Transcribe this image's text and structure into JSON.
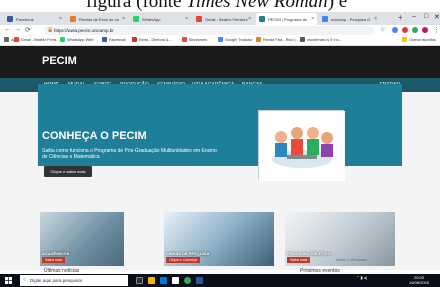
{
  "caption_above": {
    "pre": "figura (fonte ",
    "italic": "Times New Roman",
    "post": ") e"
  },
  "browser": {
    "tabs": [
      {
        "label": "Facebook",
        "color": "#3b5998"
      },
      {
        "label": "Revista de Ecos de on",
        "color": "#e67e22"
      },
      {
        "label": "WhatsApp",
        "color": "#25d366"
      },
      {
        "label": "Gmail - Beatriz Ferrarini",
        "color": "#ea4335"
      },
      {
        "label": "PECIM | Programa de",
        "color": "#1f7f99",
        "active": true
      },
      {
        "label": "unicamp - Pesquisa G",
        "color": "#4285f4"
      }
    ],
    "url": "https://www.pecim.unicamp.br",
    "bookmarks": [
      {
        "label": "Apps",
        "color": "#666"
      },
      {
        "label": "Gmail - Beatriz Ferra...",
        "color": "#ea4335"
      },
      {
        "label": "WhatsApp Web",
        "color": "#25d366"
      },
      {
        "label": "Facebook",
        "color": "#3b5998"
      },
      {
        "label": "Serta - Diretora &...",
        "color": "#c0392b"
      },
      {
        "label": "Sindromes",
        "color": "#e74c3c"
      },
      {
        "label": "Google Tradutor",
        "color": "#4285f4"
      },
      {
        "label": "Renda Fixa - Rico | ...",
        "color": "#e67e22"
      },
      {
        "label": "modelmais is !!! ho...",
        "color": "#555"
      },
      {
        "label": "Outros favoritos",
        "color": "#f1c40f"
      }
    ]
  },
  "site": {
    "logo": "PECIM",
    "nav": [
      "HOME",
      "MURAL",
      "SOBRE",
      "PRODUÇÃO",
      "SEMINÁRIO",
      "VIDA ACADÊMICA",
      "BANCAS"
    ],
    "login": "ENTRAR",
    "hero": {
      "title": "CONHEÇA O PECIM",
      "description": "Saiba como funciona o Programa de Pós-Graduação Multiunidades em Ensino de Ciências e Matemática",
      "button": "Clique e saiba mais"
    },
    "cards": [
      {
        "label": "ACADÊMICOS",
        "more": "Saiba mais"
      },
      {
        "label": "LINHAS DE PESQUISA",
        "more": "Clique e Conheça"
      },
      {
        "label": "PROCESSO SELETIVO",
        "more": "Saiba mais"
      }
    ],
    "below_cards": [
      "Últimas notícias",
      "Próximos eventos"
    ],
    "watermark": "Ativar o Windows"
  },
  "taskbar": {
    "search_placeholder": "Digite aqui para pesquisar",
    "time": "20:00",
    "date": "10/06/2020"
  }
}
